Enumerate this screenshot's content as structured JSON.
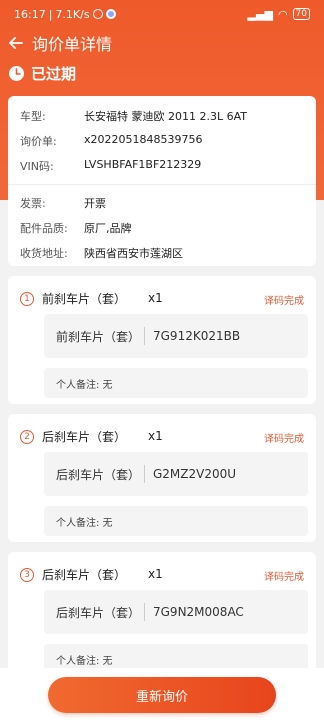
{
  "status_bar": {
    "time": "16:17",
    "speed": "7.1K/s",
    "battery": "70"
  },
  "nav": {
    "title": "询价单详情"
  },
  "status": {
    "text": "已过期"
  },
  "info": {
    "rows_top": [
      {
        "label": "车型:",
        "value": "长安福特 蒙迪欧 2011 2.3L 6AT"
      },
      {
        "label": "询价单:",
        "value": "x2022051848539756"
      },
      {
        "label": "VIN码:",
        "value": "LVSHBFAF1BF212329"
      }
    ],
    "rows_bottom": [
      {
        "label": "发票:",
        "value": "开票"
      },
      {
        "label": "配件品质:",
        "value": "原厂,品牌"
      },
      {
        "label": "收货地址:",
        "value": "陕西省西安市莲湖区"
      }
    ]
  },
  "parts": [
    {
      "index": "1",
      "name": "前刹车片（套）",
      "qty": "x1",
      "status": "译码完成",
      "code_name": "前刹车片（套）",
      "code": "7G912K021BB",
      "remark": "个人备注: 无"
    },
    {
      "index": "2",
      "name": "后刹车片（套）",
      "qty": "x1",
      "status": "译码完成",
      "code_name": "后刹车片（套）",
      "code": "G2MZ2V200U",
      "remark": "个人备注: 无"
    },
    {
      "index": "3",
      "name": "后刹车片（套）",
      "qty": "x1",
      "status": "译码完成",
      "code_name": "后刹车片（套）",
      "code": "7G9N2M008AC",
      "remark": "个人备注: 无"
    }
  ],
  "footer": {
    "button_label": "重新询价"
  },
  "colors": {
    "accent": "#ef5a2a",
    "status_text": "#e55a36"
  }
}
